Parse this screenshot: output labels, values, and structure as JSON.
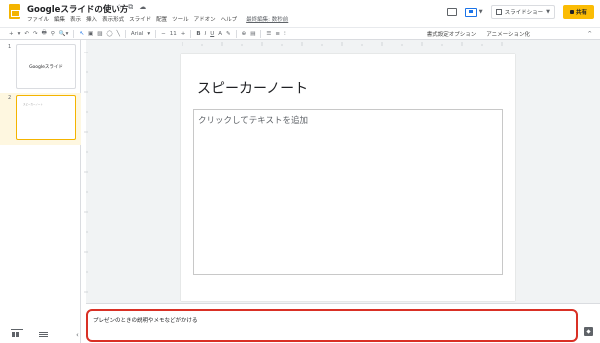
{
  "app": {
    "title": "Googleスライドの使い方",
    "title_icons": [
      "☆",
      "⧉",
      "☁"
    ],
    "last_edit": "最終編集: 数秒前"
  },
  "menu": [
    "ファイル",
    "編集",
    "表示",
    "挿入",
    "表示形式",
    "スライド",
    "配置",
    "ツール",
    "アドオン",
    "ヘルプ"
  ],
  "header": {
    "slideshow_label": "スライドショー",
    "share_label": "共有",
    "accent_color": "#fbbc04"
  },
  "toolbar": {
    "items": [
      "+",
      "▾",
      "↶",
      "↷",
      "🖶",
      "⚲",
      "🔍▾"
    ],
    "font": "Arial",
    "font_size": "11",
    "format_items": [
      "B",
      "I",
      "U",
      "A",
      "✎",
      "⊕",
      "▤",
      "☰",
      "≡",
      "⁝"
    ],
    "format_options": "書式設定オプション",
    "animation": "アニメーション化",
    "collapse": "^"
  },
  "filmstrip": {
    "slides": [
      {
        "number": "1",
        "title": "Googleスライド",
        "selected": false
      },
      {
        "number": "2",
        "text": "スピーカーノート",
        "selected": true
      }
    ],
    "accent_color": "#f4b400"
  },
  "slide": {
    "title": "スピーカーノート",
    "body_placeholder": "クリックしてテキストを追加"
  },
  "notes": {
    "text": "プレゼンのときの説明やメモなどがかける",
    "highlight_color": "#d93025"
  }
}
